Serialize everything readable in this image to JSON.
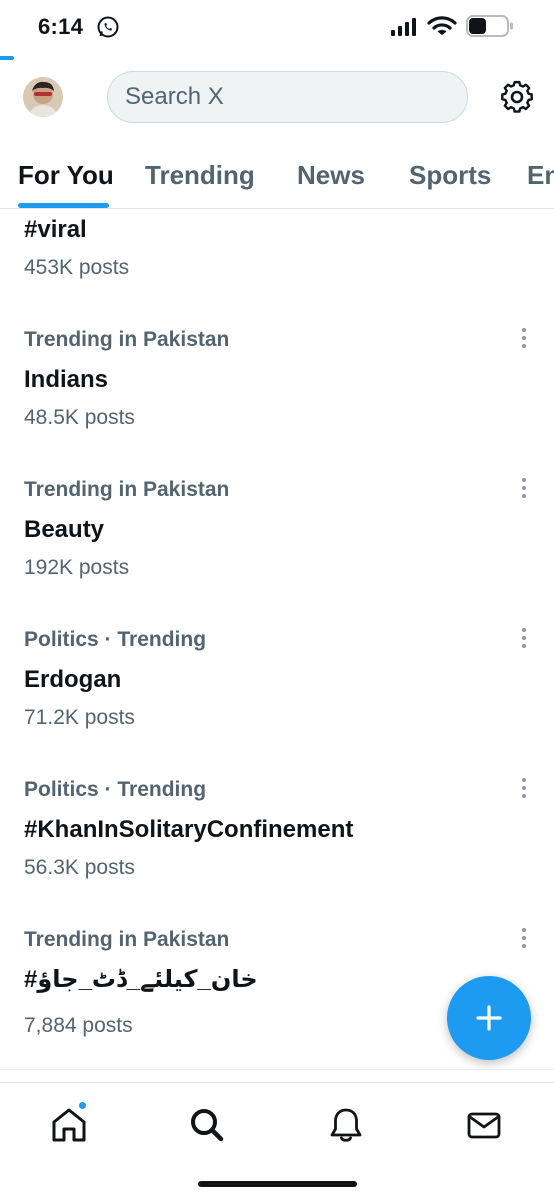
{
  "status_bar": {
    "time": "6:14",
    "icons": [
      "whatsapp-icon",
      "signal-icon",
      "wifi-icon",
      "battery-icon"
    ]
  },
  "header": {
    "avatar": "profile-avatar",
    "search_placeholder": "Search X",
    "settings_icon": "gear-icon"
  },
  "tabs": [
    {
      "label": "For You",
      "active": true
    },
    {
      "label": "Trending",
      "active": false
    },
    {
      "label": "News",
      "active": false
    },
    {
      "label": "Sports",
      "active": false
    },
    {
      "label": "En",
      "active": false
    }
  ],
  "trends": [
    {
      "context": "",
      "name": "#viral",
      "count": "453K posts"
    },
    {
      "context": "Trending in Pakistan",
      "name": "Indians",
      "count": "48.5K posts"
    },
    {
      "context": "Trending in Pakistan",
      "name": "Beauty",
      "count": "192K posts"
    },
    {
      "context": "Politics · Trending",
      "name": "Erdogan",
      "count": "71.2K posts"
    },
    {
      "context": "Politics · Trending",
      "name": "#KhanInSolitaryConfinement",
      "count": "56.3K posts"
    },
    {
      "context": "Trending in Pakistan",
      "name": "#خان_کیلئے_ڈٹ_جاؤ",
      "count": "7,884 posts"
    }
  ],
  "fab": {
    "icon": "plus-icon"
  },
  "bottom_nav": [
    {
      "icon": "home-icon",
      "has_notification_dot": true
    },
    {
      "icon": "search-icon",
      "has_notification_dot": false
    },
    {
      "icon": "bell-icon",
      "has_notification_dot": false
    },
    {
      "icon": "mail-icon",
      "has_notification_dot": false
    }
  ],
  "colors": {
    "accent": "#1d9bf0",
    "text_primary": "#0f1419",
    "text_secondary": "#536471"
  }
}
